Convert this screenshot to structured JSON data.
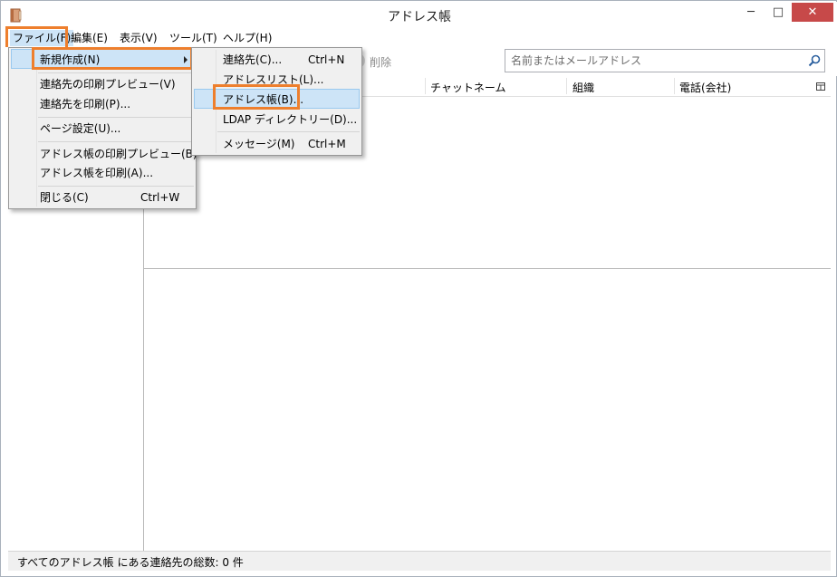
{
  "window": {
    "title": "アドレス帳",
    "controls": {
      "minimize": "─",
      "maximize": "□",
      "close": "✕"
    }
  },
  "menubar": {
    "items": [
      "ファイル(F)",
      "編集(E)",
      "表示(V)",
      "ツール(T)",
      "ヘルプ(H)"
    ]
  },
  "toolbar": {
    "delete_label": "削除",
    "search_placeholder": "名前またはメールアドレス"
  },
  "columns": [
    "チャットネーム",
    "組織",
    "電話(会社)"
  ],
  "status": {
    "text": "すべてのアドレス帳 にある連絡先の総数: 0 件"
  },
  "file_menu": {
    "new": "新規作成(N)",
    "print_preview_contact": "連絡先の印刷プレビュー(V)",
    "print_contact": "連絡先を印刷(P)...",
    "page_setup": "ページ設定(U)...",
    "print_preview_book": "アドレス帳の印刷プレビュー(B)",
    "print_book": "アドレス帳を印刷(A)...",
    "close": "閉じる(C)",
    "close_shortcut": "Ctrl+W"
  },
  "new_menu": {
    "contact": "連絡先(C)...",
    "contact_shortcut": "Ctrl+N",
    "mailing_list": "アドレスリスト(L)...",
    "address_book": "アドレス帳(B)...",
    "ldap": "LDAP ディレクトリー(D)...",
    "message": "メッセージ(M)",
    "message_shortcut": "Ctrl+M"
  },
  "colors": {
    "highlight": "#ee7f2d",
    "selection": "#cde4f7",
    "close_button": "#c74949"
  },
  "icons": {
    "app": "address-book-icon",
    "search": "search-icon",
    "column_picker": "column-picker-icon",
    "submenu_arrow": "submenu-arrow-icon"
  }
}
